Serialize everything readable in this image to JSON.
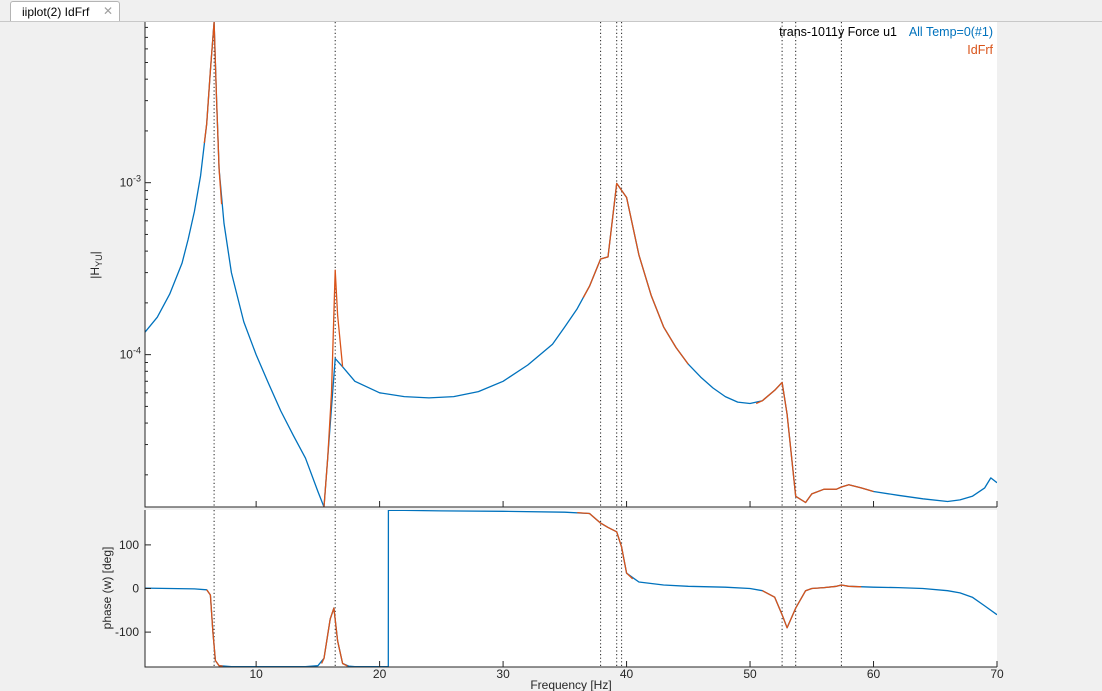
{
  "tab": {
    "label": "iiplot(2) IdFrf",
    "close_icon": "close-icon"
  },
  "colors": {
    "measured": "#0072bd",
    "identified": "#d95319",
    "axes_bg": "#ffffff",
    "fig_bg": "#f0f0f0"
  },
  "legend": {
    "title": "trans-1011y Force u1",
    "series1": "All Temp=0(#1)",
    "series2": "IdFrf"
  },
  "chart_data": [
    {
      "type": "line",
      "title": "",
      "xlabel": "",
      "ylabel": "|H_YU|",
      "yscale": "log",
      "xlim": [
        1,
        70
      ],
      "ylim": [
        1.3e-05,
        0.0086
      ],
      "yticks": [
        0.0001,
        0.001
      ],
      "ytick_labels": [
        "10-4",
        "10-3"
      ],
      "xticks": [
        10,
        20,
        30,
        40,
        50,
        60,
        70
      ],
      "grid": false,
      "legend_position": "top-right",
      "mode_lines": [
        6.6,
        16.4,
        37.9,
        39.2,
        39.6,
        52.6,
        53.7,
        57.4
      ],
      "series": [
        {
          "name": "All Temp=0(#1)",
          "color": "#0072bd",
          "x": [
            1,
            2,
            3,
            4,
            4.5,
            5,
            5.5,
            6,
            6.3,
            6.6,
            6.8,
            7,
            7.4,
            8,
            9,
            10,
            11,
            12,
            13,
            14,
            15,
            15.5,
            16.4,
            17,
            18,
            20,
            22,
            24,
            26,
            28,
            30,
            32,
            34,
            35,
            36,
            37,
            37.9,
            38.5,
            39.2,
            40,
            41,
            42,
            43,
            44,
            45,
            46,
            47,
            48,
            49,
            50,
            51,
            52,
            52.6,
            53,
            53.7,
            54.5,
            55,
            56,
            57,
            57.4,
            58,
            59,
            60,
            62,
            64,
            66,
            67,
            68,
            69,
            69.5,
            70
          ],
          "y": [
            0.000135,
            0.000165,
            0.000225,
            0.00034,
            0.00047,
            0.00068,
            0.0011,
            0.0022,
            0.0045,
            0.0086,
            0.003,
            0.0012,
            0.00058,
            0.0003,
            0.000155,
            0.0001,
            6.8e-05,
            4.7e-05,
            3.4e-05,
            2.5e-05,
            1.6e-05,
            1.3e-05,
            9.5e-05,
            8.5e-05,
            7e-05,
            6e-05,
            5.7e-05,
            5.6e-05,
            5.7e-05,
            6.1e-05,
            7e-05,
            8.7e-05,
            0.000115,
            0.000145,
            0.000185,
            0.00025,
            0.00036,
            0.00037,
            0.00099,
            0.00082,
            0.00038,
            0.00022,
            0.000145,
            0.00011,
            8.8e-05,
            7.4e-05,
            6.4e-05,
            5.7e-05,
            5.3e-05,
            5.2e-05,
            5.4e-05,
            6.2e-05,
            6.9e-05,
            4.5e-05,
            1.5e-05,
            1.38e-05,
            1.55e-05,
            1.65e-05,
            1.65e-05,
            1.7e-05,
            1.75e-05,
            1.68e-05,
            1.6e-05,
            1.52e-05,
            1.45e-05,
            1.4e-05,
            1.43e-05,
            1.5e-05,
            1.68e-05,
            1.92e-05,
            1.8e-05
          ]
        },
        {
          "name": "IdFrf",
          "color": "#d95319",
          "segments": [
            {
              "x": [
                5.8,
                6,
                6.3,
                6.6,
                6.8,
                7,
                7.2
              ],
              "y": [
                0.0017,
                0.0022,
                0.0045,
                0.0086,
                0.003,
                0.0012,
                0.00075
              ]
            },
            {
              "x": [
                15.5,
                15.8,
                16.1,
                16.4,
                16.6,
                17
              ],
              "y": [
                1.3e-05,
                2.5e-05,
                6e-05,
                0.00031,
                0.00017,
                8.5e-05
              ]
            },
            {
              "x": [
                36.5,
                37,
                37.9,
                38.5,
                39.2,
                40,
                41,
                42,
                43,
                44,
                45
              ],
              "y": [
                0.000215,
                0.00025,
                0.00036,
                0.00037,
                0.00099,
                0.00082,
                0.00038,
                0.00022,
                0.000145,
                0.00011,
                8.8e-05
              ]
            },
            {
              "x": [
                50.5,
                51,
                52,
                52.6,
                53,
                53.7,
                54.5,
                55,
                56,
                57,
                57.4,
                58,
                59,
                60
              ],
              "y": [
                5.2e-05,
                5.4e-05,
                6.2e-05,
                6.9e-05,
                4.5e-05,
                1.5e-05,
                1.38e-05,
                1.55e-05,
                1.65e-05,
                1.65e-05,
                1.7e-05,
                1.75e-05,
                1.68e-05,
                1.6e-05
              ]
            }
          ]
        }
      ]
    },
    {
      "type": "line",
      "title": "",
      "xlabel": "Frequency [Hz]",
      "ylabel": "phase (w) [deg]",
      "xlim": [
        1,
        70
      ],
      "ylim": [
        -180,
        180
      ],
      "yticks": [
        -100,
        0,
        100
      ],
      "xticks": [
        10,
        20,
        30,
        40,
        50,
        60,
        70
      ],
      "grid": false,
      "mode_lines": [
        6.6,
        16.4,
        37.9,
        39.2,
        39.6,
        52.6,
        53.7,
        57.4
      ],
      "series": [
        {
          "name": "All Temp=0(#1)",
          "color": "#0072bd",
          "x": [
            1,
            3,
            5,
            6,
            6.3,
            6.5,
            6.7,
            7,
            8,
            10,
            12,
            14,
            15,
            15.5,
            16,
            16.3,
            16.6,
            17,
            17.5,
            18,
            19,
            20,
            20.7,
            20.71,
            22,
            25,
            30,
            35,
            37,
            37.9,
            38.5,
            39.2,
            39.6,
            40,
            41,
            43,
            45,
            48,
            50,
            51,
            52,
            52.6,
            53,
            53.7,
            54.5,
            55,
            56,
            57,
            57.4,
            58,
            60,
            62,
            64,
            66,
            67,
            68,
            69,
            70
          ],
          "y": [
            1,
            0,
            -1,
            -3,
            -15,
            -100,
            -165,
            -177,
            -179,
            -179,
            -179,
            -179,
            -177,
            -160,
            -70,
            -45,
            -120,
            -172,
            -178,
            -179,
            -179,
            -179,
            -179,
            179,
            179,
            178,
            177,
            175,
            172,
            150,
            140,
            130,
            95,
            35,
            15,
            8,
            5,
            3,
            0,
            -5,
            -20,
            -60,
            -90,
            -45,
            -5,
            0,
            2,
            5,
            8,
            5,
            3,
            2,
            0,
            -5,
            -10,
            -20,
            -40,
            -60
          ]
        },
        {
          "name": "IdFrf",
          "color": "#d95319",
          "segments": [
            {
              "x": [
                6,
                6.3,
                6.5,
                6.7,
                7,
                7.3
              ],
              "y": [
                -3,
                -15,
                -100,
                -165,
                -177,
                -178
              ]
            },
            {
              "x": [
                15.3,
                15.5,
                16,
                16.3,
                16.6,
                17,
                17.4
              ],
              "y": [
                -172,
                -160,
                -70,
                -45,
                -120,
                -172,
                -178
              ]
            },
            {
              "x": [
                36,
                37,
                37.9,
                38.5,
                39.2,
                39.6,
                40,
                40.5
              ],
              "y": [
                174,
                172,
                150,
                140,
                130,
                95,
                35,
                22
              ]
            },
            {
              "x": [
                51,
                52,
                52.6,
                53,
                53.7,
                54.5,
                55,
                56,
                57,
                57.4,
                58,
                59
              ],
              "y": [
                -5,
                -20,
                -60,
                -90,
                -45,
                -5,
                0,
                2,
                5,
                8,
                5,
                4
              ]
            }
          ]
        }
      ]
    }
  ]
}
